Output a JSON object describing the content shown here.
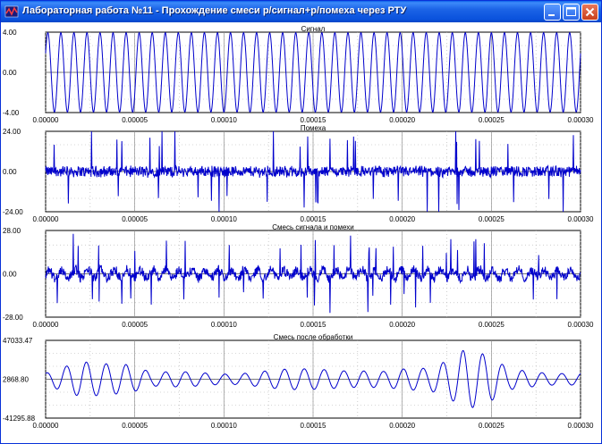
{
  "window": {
    "title": "Лабораторная работа №11 - Прохождение смеси р/сигнал+р/помеха через РТУ",
    "minimize_icon": "minimize-icon",
    "maximize_icon": "maximize-icon",
    "close_icon": "close-icon",
    "colors": {
      "titlebar": "#0a52dd",
      "plot_line": "#0000cc"
    }
  },
  "chart_data": [
    {
      "type": "line",
      "title": "Сигнал",
      "ylim": [
        -4.0,
        4.0
      ],
      "ytick_labels": [
        "4.00",
        "0.00",
        "-4.00"
      ],
      "xlim": [
        0,
        0.0003
      ],
      "xtick_labels": [
        "0.00000",
        "0.00005",
        "0.00010",
        "0.00015",
        "0.00020",
        "0.00025",
        "0.00030"
      ],
      "grid": true,
      "series": [
        {
          "kind": "sine",
          "amplitude": 3.95,
          "cycles": 41
        }
      ]
    },
    {
      "type": "line",
      "title": "Помеха",
      "ylim": [
        -24.0,
        24.0
      ],
      "ytick_labels": [
        "24.00",
        "0.00",
        "-24.00"
      ],
      "xlim": [
        0,
        0.0003
      ],
      "xtick_labels": [
        "0.00000",
        "0.00005",
        "0.00010",
        "0.00015",
        "0.00020",
        "0.00025",
        "0.00030"
      ],
      "grid": true,
      "series": [
        {
          "kind": "impulse-noise",
          "noise_level": 3,
          "spike_height": 24
        }
      ]
    },
    {
      "type": "line",
      "title": "Смесь сигнала и помехи",
      "ylim": [
        -28.0,
        28.0
      ],
      "ytick_labels": [
        "28.00",
        "0.00",
        "-28.00"
      ],
      "xlim": [
        0,
        0.0003
      ],
      "xtick_labels": [
        "0.00000",
        "0.00005",
        "0.00010",
        "0.00015",
        "0.00020",
        "0.00025",
        "0.00030"
      ],
      "grid": true,
      "series": [
        {
          "kind": "impulse-noise-plus-signal",
          "noise_level": 3,
          "spike_height": 22
        }
      ]
    },
    {
      "type": "line",
      "title": "Смесь после обработки",
      "ylim": [
        -41295.88,
        47033.47
      ],
      "ytick_labels": [
        "47033.47",
        "2868.80",
        "-41295.88"
      ],
      "xlim": [
        0,
        0.0003
      ],
      "xtick_labels": [
        "0.00000",
        "0.00005",
        "0.00010",
        "0.00015",
        "0.00020",
        "0.00025",
        "0.00030"
      ],
      "grid": true,
      "series": [
        {
          "kind": "filtered",
          "center": 2868.8,
          "envelope": [
            [
              0,
              8000
            ],
            [
              2e-05,
              20000
            ],
            [
              4.5e-05,
              24000
            ],
            [
              6e-05,
              9000
            ],
            [
              0.0001,
              8000
            ],
            [
              0.00014,
              12000
            ],
            [
              0.00016,
              15000
            ],
            [
              0.00019,
              9000
            ],
            [
              0.000215,
              16000
            ],
            [
              0.000235,
              44000
            ],
            [
              0.00026,
              12000
            ],
            [
              0.0003,
              8000
            ]
          ]
        }
      ]
    }
  ]
}
